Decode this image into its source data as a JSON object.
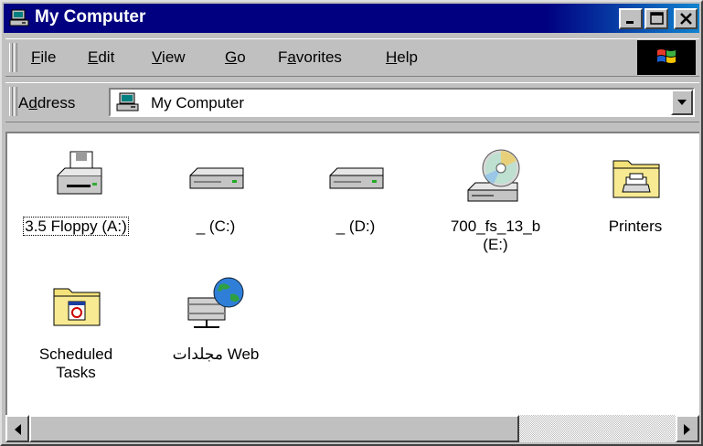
{
  "window": {
    "title": "My Computer",
    "controls": {
      "minimize_icon": "minimize-icon",
      "maximize_icon": "maximize-icon",
      "close_icon": "close-icon"
    }
  },
  "menubar": {
    "items": [
      {
        "label": "File",
        "accel": "F",
        "rest": "ile"
      },
      {
        "label": "Edit",
        "accel": "E",
        "rest": "dit"
      },
      {
        "label": "View",
        "accel": "V",
        "rest": "iew"
      },
      {
        "label": "Go",
        "accel": "G",
        "rest": "o"
      },
      {
        "label": "Favorites",
        "pre": "F",
        "accel": "a",
        "rest": "vorites"
      },
      {
        "label": "Help",
        "accel": "H",
        "rest": "elp"
      }
    ],
    "logo_icon": "windows-logo-icon"
  },
  "address": {
    "label_pre": "A",
    "label_accel": "d",
    "label_rest": "dress",
    "value": "My Computer",
    "icon": "computer-icon"
  },
  "items": [
    {
      "label": "3.5 Floppy (A:)",
      "icon": "floppy-drive-icon",
      "selected": true
    },
    {
      "label": "_ (C:)",
      "icon": "hard-drive-icon"
    },
    {
      "label": "_ (D:)",
      "icon": "hard-drive-icon"
    },
    {
      "label": "700_fs_13_b\n(E:)",
      "icon": "cd-drive-icon"
    },
    {
      "label": "Printers",
      "icon": "printers-folder-icon"
    },
    {
      "label": "Scheduled\nTasks",
      "icon": "scheduled-tasks-folder-icon"
    },
    {
      "label": "مجلدات Web",
      "icon": "web-folders-icon"
    }
  ]
}
